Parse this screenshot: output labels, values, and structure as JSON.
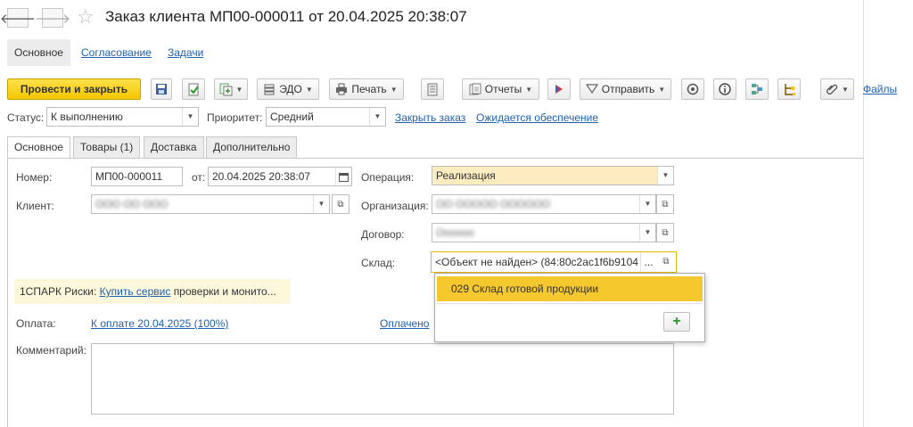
{
  "window": {
    "title": "Заказ клиента МП00-000011 от 20.04.2025 20:38:07"
  },
  "nav": {
    "back": "🡐",
    "forward": "🡒",
    "star": "☆"
  },
  "top_tabs": [
    "Основное",
    "Согласование",
    "Задачи"
  ],
  "toolbar": {
    "post_close": "Провести и закрыть",
    "edo": "ЭДО",
    "print": "Печать",
    "reports": "Отчеты",
    "send": "Отправить",
    "files": "Файлы"
  },
  "status_row": {
    "status_label": "Статус:",
    "status_value": "К выполнению",
    "priority_label": "Приоритет:",
    "priority_value": "Средний",
    "close_order": "Закрыть заказ",
    "awaiting": "Ожидается обеспечение"
  },
  "inner_tabs": [
    "Основное",
    "Товары (1)",
    "Доставка",
    "Дополнительно"
  ],
  "form": {
    "number_label": "Номер:",
    "number_value": "МП00-000011",
    "from_label": "от:",
    "date_value": "20.04.2025 20:38:07",
    "client_label": "Клиент:",
    "client_value": "ООО ОО ООО",
    "operation_label": "Операция:",
    "operation_value": "Реализация",
    "org_label": "Организация:",
    "org_value": "ОО ООООО ОООООО",
    "contract_label": "Договор:",
    "contract_value": "Оооооо",
    "warehouse_label": "Склад:",
    "warehouse_value": "<Объект не найден> (84:80c2ac1f6b9104",
    "warehouse_dots": "...",
    "spark_prefix": "1СПАРК Риски:",
    "spark_link": "Купить сервис",
    "spark_rest": "проверки и монито...",
    "payment_label": "Оплата:",
    "payment_link": "К оплате 20.04.2025 (100%)",
    "paid_link": "Оплачено",
    "comment_label": "Комментарий:"
  },
  "dropdown": {
    "item": "029 Склад готовой продукции",
    "add": "+"
  },
  "colors": {
    "accent": "#f3c600",
    "link": "#2060b0",
    "highlight": "#fcecc0"
  }
}
